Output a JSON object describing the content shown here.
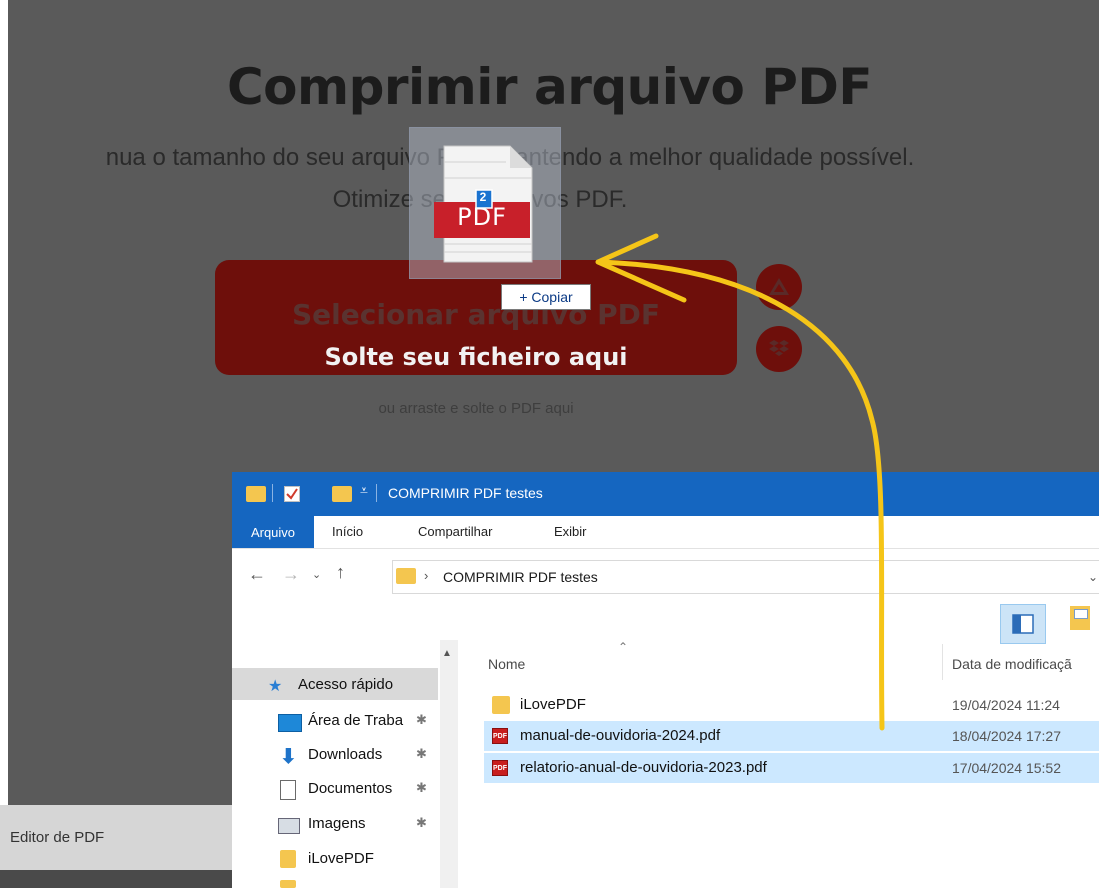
{
  "page": {
    "title": "Comprimir arquivo PDF",
    "subtitle_line1": "nua o tamanho do seu arquivo PDF, mantendo a melhor qualidade possível.",
    "subtitle_line2": "Otimize seus arquivos PDF.",
    "select_button": "Selecionar arquivo PDF",
    "drop_label": "Solte seu ficheiro aqui",
    "drag_hint": "ou arraste e solte o PDF aqui",
    "cloud_services": [
      "google-drive-icon",
      "dropbox-icon"
    ]
  },
  "drag": {
    "file_type": "PDF",
    "count": "2",
    "tooltip": "+ Copiar"
  },
  "taskbar": {
    "editor_label": "Editor de PDF"
  },
  "explorer": {
    "title": "COMPRIMIR PDF testes",
    "ribbon_tabs": [
      "Arquivo",
      "Início",
      "Compartilhar",
      "Exibir"
    ],
    "address": "COMPRIMIR PDF testes",
    "columns": [
      "Nome",
      "Data de modificaçã"
    ],
    "nav_items": [
      {
        "label": "Acesso rápido",
        "icon": "star-icon"
      },
      {
        "label": "Área de Traba",
        "icon": "desktop-icon",
        "pinned": true
      },
      {
        "label": "Downloads",
        "icon": "download-icon",
        "pinned": true
      },
      {
        "label": "Documentos",
        "icon": "document-icon",
        "pinned": true
      },
      {
        "label": "Imagens",
        "icon": "image-icon",
        "pinned": true
      },
      {
        "label": "iLovePDF",
        "icon": "folder-icon"
      }
    ],
    "files": [
      {
        "name": "iLovePDF",
        "type": "folder",
        "date": "19/04/2024 11:24",
        "selected": false
      },
      {
        "name": "manual-de-ouvidoria-2024.pdf",
        "type": "pdf",
        "date": "18/04/2024 17:27",
        "selected": true
      },
      {
        "name": "relatorio-anual-de-ouvidoria-2023.pdf",
        "type": "pdf",
        "date": "17/04/2024 15:52",
        "selected": true
      }
    ]
  },
  "colors": {
    "accent_red": "#6e0f0b",
    "explorer_blue": "#1566c0",
    "annotation_arrow": "#f5c518",
    "selection": "#cce8ff"
  }
}
